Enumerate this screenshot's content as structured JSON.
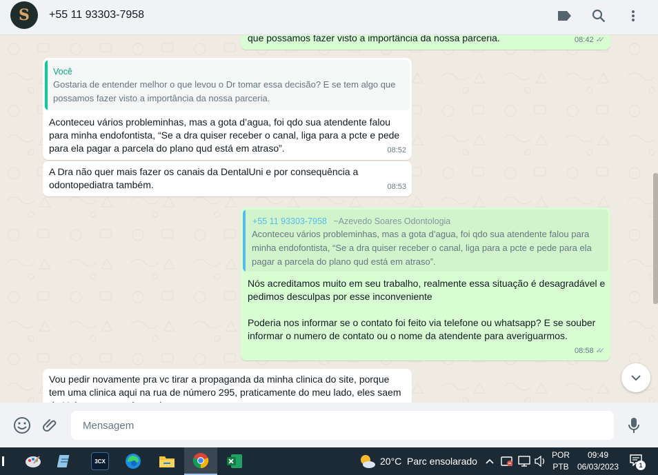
{
  "header": {
    "contact_name": "+55 11 93303-7958",
    "avatar_letter": "S"
  },
  "messages": [
    {
      "id": "m0",
      "direction": "out",
      "text": "que possamos fazer visto a importância da nossa parceria.",
      "time": "08:42"
    },
    {
      "id": "m1",
      "direction": "in",
      "quote": {
        "author": "Você",
        "text": "Gostaria de entender melhor o que levou o Dr tomar essa decisão? E se tem algo que possamos fazer visto a importância da nossa parceria."
      },
      "text": "Aconteceu vários probleminhas, mas a gota d’agua, foi qdo sua atendente falou para minha endofontista, “Se a dra quiser receber o canal, liga para a pcte e pede para ela pagar a parcela do plano qud está em atraso”.",
      "time": "08:52"
    },
    {
      "id": "m2",
      "direction": "in",
      "text": "A Dra não quer mais fazer os canais da DentalUni e por consequência a odontopediatra também.",
      "time": "08:53"
    },
    {
      "id": "m3",
      "direction": "out",
      "quote": {
        "author": "+55 11 93303-7958",
        "author_suffix": "~Azevedo Soares Odontologia",
        "text": "Aconteceu vários probleminhas, mas a gota d’agua, foi qdo sua atendente falou para minha endofontista, “Se a dra quiser receber o canal, liga para a pcte e pede para ela pagar a parcela do plano qud está em atraso”."
      },
      "text": "Nós acreditamos muito em seu trabalho, realmente essa situação é desagradável e pedimos desculpas por esse inconveniente\n\nPoderia nos informar se o contato foi feito via telefone ou whatsapp? E se souber informar o numero de contato ou o nome da atendente para averiguarmos.",
      "time": "08:58"
    },
    {
      "id": "m4",
      "direction": "in",
      "text": "Vou pedir novamente pra vc tirar a propaganda da minha clinica do site, porque tem uma clinica aqui na rua de número 295, praticamente do meu lado, eles saem da Uni e vem pra cá, preciso",
      "time": ""
    }
  ],
  "composer": {
    "placeholder": "Mensagem"
  },
  "taskbar": {
    "apps": [
      "paint-app",
      "notepad-app",
      "3cx-app",
      "edge-app",
      "file-explorer-app",
      "chrome-app",
      "excel-app"
    ],
    "app_3cx_label": "3CX",
    "weather_temp": "20°C",
    "weather_desc": "Parc ensolarado",
    "lang_top": "POR",
    "lang_bottom": "PTB",
    "clock_time": "09:49",
    "clock_date": "06/03/2023",
    "notifications_count": "1"
  },
  "colors": {
    "accent_green": "#1fa855",
    "quote_out_author": "#53bdeb",
    "out_bubble": "#d9fdd3",
    "in_bubble": "#ffffff"
  }
}
